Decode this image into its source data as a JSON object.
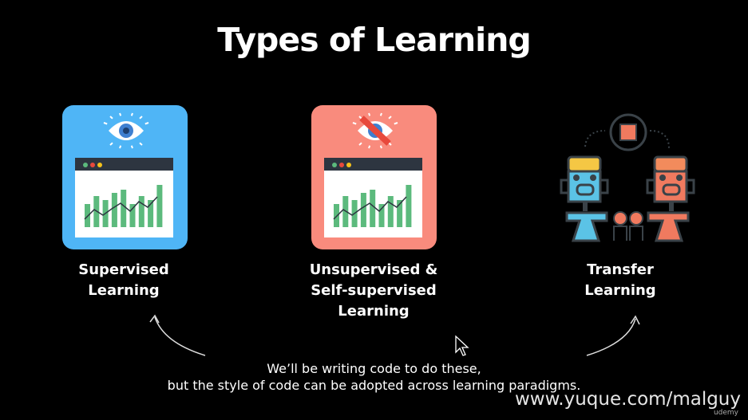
{
  "title": "Types of Learning",
  "cards": [
    {
      "label_line1": "Supervised",
      "label_line2": "Learning",
      "color": "#4fb5f6",
      "icon": "eye-icon"
    },
    {
      "label_line1": "Unsupervised &",
      "label_line2": "Self-supervised",
      "label_line3": "Learning",
      "color": "#f98b7d",
      "icon": "eye-crossed-icon"
    },
    {
      "label_line1": "Transfer",
      "label_line2": "Learning",
      "icon": "robots-transfer-icon"
    }
  ],
  "note": {
    "line1": "We’ll be writing code to do these,",
    "line2": "but the style of code can be adopted across learning paradigms."
  },
  "watermark": "www.yuque.com/malguy",
  "brand": "udemy"
}
